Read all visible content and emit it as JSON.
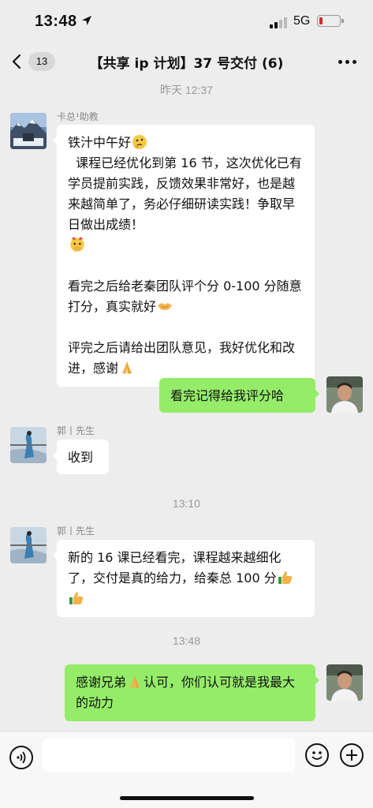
{
  "status": {
    "time": "13:48",
    "network": "5G"
  },
  "nav": {
    "unread_count": "13",
    "title": "【共享 ip 计划】37 号交付 (6)"
  },
  "messages": [
    {
      "type": "time",
      "text": "昨天 12:37"
    },
    {
      "type": "msg",
      "sender": "卡总¹助教",
      "side": "left",
      "line1": "铁汁中午好",
      "body": "  课程已经优化到第 16 节，这次优化已有学员提前实践，反馈效果非常好，也是越来越简单了，务必仔细研读实践！争取早日做出成绩！",
      "para2": "看完之后给老秦团队评个分 0-100 分随意打分，真实就好",
      "para3": "评完之后请给出团队意见，我好优化和改进，感谢"
    },
    {
      "type": "msg",
      "side": "right",
      "text": "看完记得给我评分哈"
    },
    {
      "type": "msg",
      "sender": "郭丨先生",
      "side": "left",
      "text": "收到"
    },
    {
      "type": "time",
      "text": "13:10"
    },
    {
      "type": "msg",
      "sender": "郭丨先生",
      "side": "left",
      "text": "新的 16 课已经看完，课程越来越细化了，交付是真的给力，给秦总 100 分"
    },
    {
      "type": "time",
      "text": "13:48"
    },
    {
      "type": "msg",
      "side": "right",
      "text_a": "感谢兄弟",
      "text_b": "认可，你们认可就是我最大的动力"
    }
  ],
  "icons": {
    "location": "location-arrow-icon",
    "signal": "signal-bars-icon",
    "battery": "battery-icon",
    "back": "chevron-left-icon",
    "more": "more-dots-icon",
    "voice": "voice-icon",
    "emoji": "emoji-icon",
    "plus": "plus-icon"
  }
}
